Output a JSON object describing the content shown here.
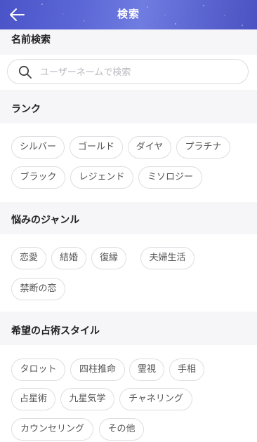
{
  "header": {
    "title": "検索",
    "back_icon": "arrow-left-icon"
  },
  "name_search": {
    "heading": "名前検索",
    "placeholder": "ユーザーネームで検索",
    "icon": "search-icon"
  },
  "rank": {
    "heading": "ランク",
    "chips": [
      "シルバー",
      "ゴールド",
      "ダイヤ",
      "プラチナ",
      "ブラック",
      "レジェンド",
      "ミソロジー"
    ]
  },
  "genre": {
    "heading": "悩みのジャンル",
    "chips": [
      "恋愛",
      "結婚",
      "復縁",
      "夫婦生活",
      "禁断の恋"
    ]
  },
  "style": {
    "heading": "希望の占術スタイル",
    "chips": [
      "タロット",
      "四柱推命",
      "霊視",
      "手相",
      "占星術",
      "九星気学",
      "チャネリング",
      "カウンセリング",
      "その他"
    ]
  },
  "colors": {
    "header_start": "#4a54c8",
    "header_mid": "#6f7ce0",
    "background": "#f6f6f9",
    "chip_border": "#dedee3"
  }
}
